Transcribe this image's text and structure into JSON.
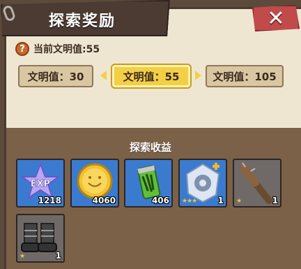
{
  "window": {
    "title": "探索奖励"
  },
  "close": {
    "label": "✕"
  },
  "current": {
    "label": "当前文明值:55",
    "icon": "question-icon"
  },
  "tiers": [
    {
      "label": "文明值：30",
      "state": "inactive"
    },
    {
      "label": "文明值：55",
      "state": "active"
    },
    {
      "label": "文明值：105",
      "state": "inactive"
    }
  ],
  "rewards": {
    "title": "探索收益",
    "items": [
      {
        "name": "exp",
        "count": "1218"
      },
      {
        "name": "coin",
        "count": "4060"
      },
      {
        "name": "energy-drink",
        "count": "406"
      },
      {
        "name": "gear-token",
        "count": "1",
        "stars": 3
      },
      {
        "name": "nail-bat",
        "count": "1",
        "stars": 1
      },
      {
        "name": "boots",
        "count": "1",
        "stars": 1
      }
    ]
  },
  "colors": {
    "panel_bg": "#efe6d2",
    "title_bg": "#4b3b33",
    "close_bg": "#c14a4a",
    "tier_active": "#f3cf46",
    "tier_inactive": "#d9c6a2",
    "rewards_bg": "#7b6148",
    "slot_blue": "#3a7bd0",
    "slot_gray": "#6f6a67"
  }
}
